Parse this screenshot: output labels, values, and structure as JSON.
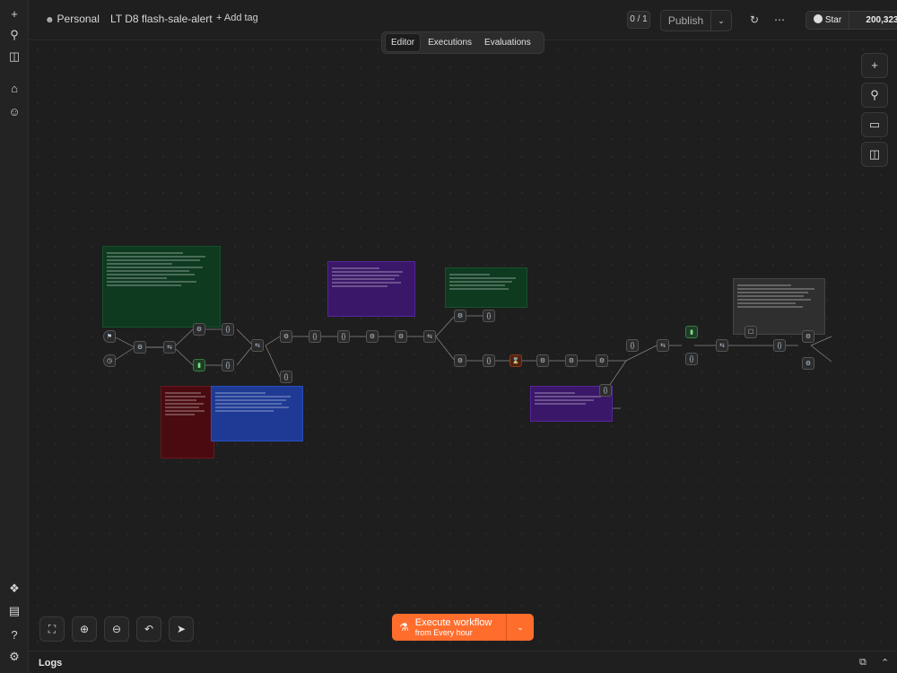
{
  "header": {
    "project": "Personal",
    "workflow_name": "LT D8 flash-sale-alert",
    "add_tag": "+ Add tag",
    "version_badge": "0 / 1",
    "publish_label": "Publish",
    "star_label": "Star",
    "star_count": "200,323"
  },
  "tabs": [
    "Editor",
    "Executions",
    "Evaluations"
  ],
  "execute": {
    "title": "Execute workflow",
    "subtitle": "from Every hour"
  },
  "logs": {
    "label": "Logs"
  },
  "icons": {
    "rail_top": [
      "plus-icon",
      "search-icon",
      "sidebar-toggle-icon",
      "home-icon",
      "user-icon"
    ],
    "rail_bottom": [
      "cube-icon",
      "chart-icon",
      "help-icon",
      "settings-icon"
    ],
    "right_toolbar": [
      "plus-icon",
      "search-icon",
      "sticky-note-icon",
      "panel-icon"
    ],
    "zoom_controls": [
      "fit-view-icon",
      "zoom-in-icon",
      "zoom-out-icon",
      "undo-icon",
      "cursor-icon"
    ]
  },
  "colors": {
    "accent": "#ff6d2d",
    "note_green": "#0e3a20",
    "note_purple": "#3a1768",
    "note_red": "#4a0b10",
    "note_blue": "#1e3a94",
    "note_gray": "#2f2f2f"
  }
}
